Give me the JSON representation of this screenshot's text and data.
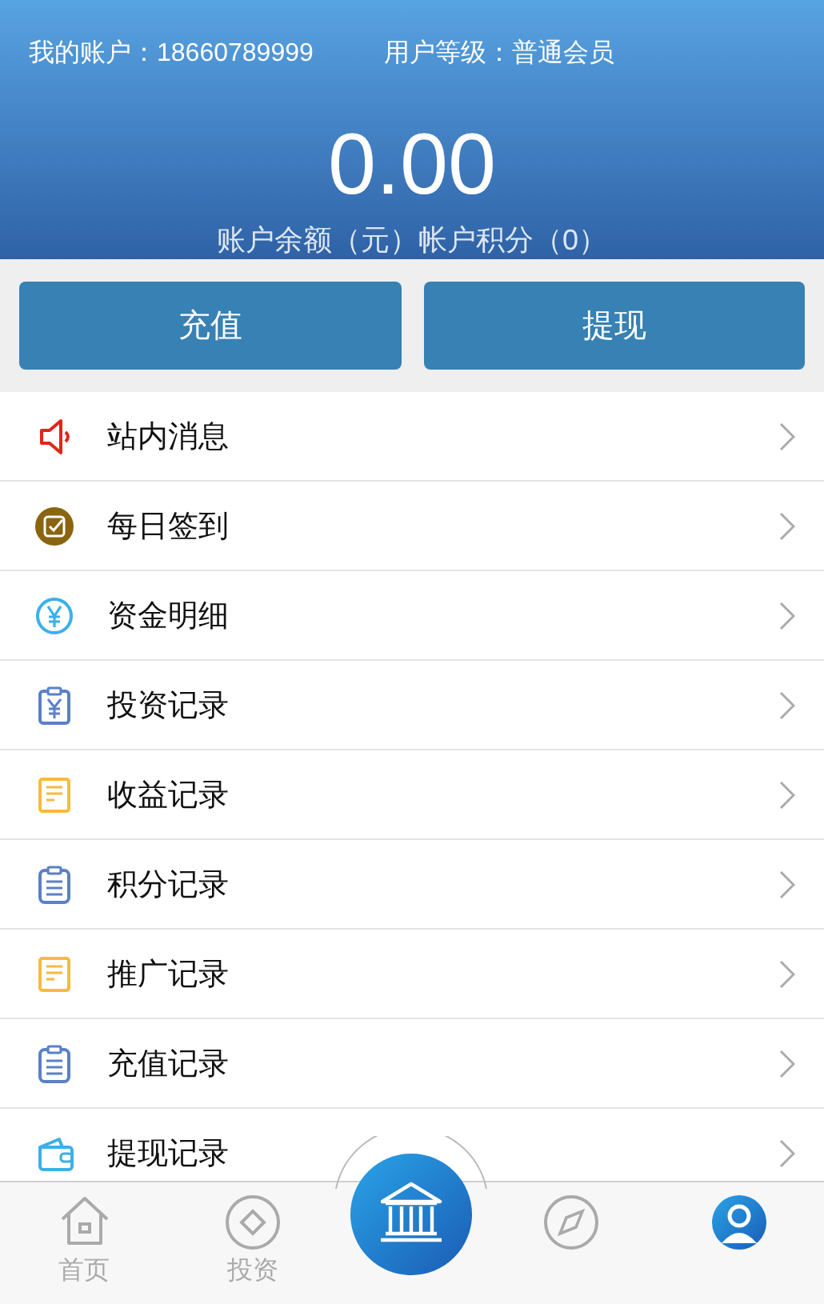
{
  "header": {
    "account": "我的账户：18660789999",
    "level": "用户等级：普通会员",
    "balance": "0.00",
    "caption": "账户余额（元）帐户积分（0）"
  },
  "actions": [
    "充值",
    "提现"
  ],
  "menu": [
    {
      "label": "站内消息"
    },
    {
      "label": "每日签到"
    },
    {
      "label": "资金明细"
    },
    {
      "label": "投资记录"
    },
    {
      "label": "收益记录"
    },
    {
      "label": "积分记录"
    },
    {
      "label": "推广记录"
    },
    {
      "label": "充值记录"
    },
    {
      "label": "提现记录"
    }
  ],
  "tabbar": [
    {
      "kind": "tab",
      "label": "首页",
      "selected": false
    },
    {
      "kind": "tab",
      "label": "投资",
      "selected": false
    },
    {
      "kind": "center",
      "selected": false
    },
    {
      "kind": "tab",
      "selected": false
    },
    {
      "kind": "tab",
      "selected": true
    }
  ]
}
